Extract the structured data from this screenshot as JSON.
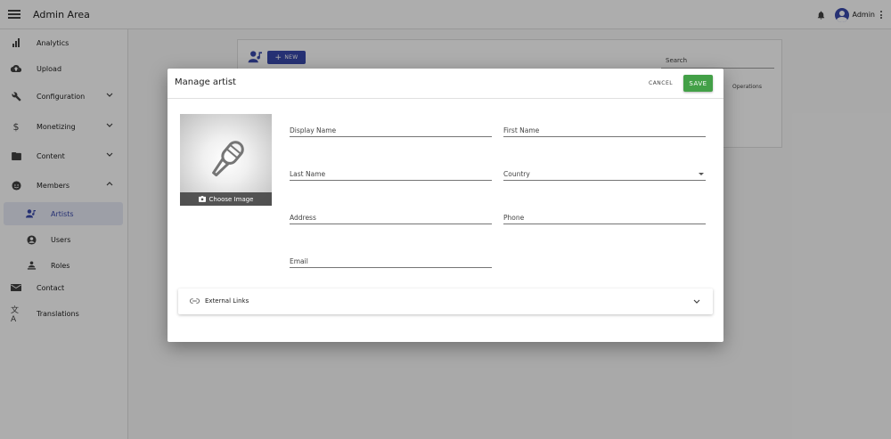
{
  "app": {
    "title": "Admin Area",
    "user_label": "Admin"
  },
  "sidebar": {
    "items": [
      {
        "label": "Analytics",
        "icon": "bar-chart-icon"
      },
      {
        "label": "Upload",
        "icon": "cloud-upload-icon"
      },
      {
        "label": "Configuration",
        "icon": "wrench-icon"
      },
      {
        "label": "Monetizing",
        "icon": "dollar-icon"
      },
      {
        "label": "Content",
        "icon": "folder-icon"
      },
      {
        "label": "Members",
        "icon": "face-icon"
      },
      {
        "label": "Artists",
        "icon": "artist-icon"
      },
      {
        "label": "Users",
        "icon": "account-circle-icon"
      },
      {
        "label": "Roles",
        "icon": "roles-icon"
      },
      {
        "label": "Contact",
        "icon": "mail-icon"
      },
      {
        "label": "Translations",
        "icon": "translate-icon"
      }
    ]
  },
  "background": {
    "new_label": "NEW",
    "search_label": "Search",
    "operations_label": "Operations"
  },
  "dialog": {
    "title": "Manage artist",
    "cancel_label": "CANCEL",
    "save_label": "SAVE",
    "choose_image_label": "Choose Image",
    "fields": {
      "display_name": "Display Name",
      "first_name": "First Name",
      "last_name": "Last Name",
      "country": "Country",
      "address": "Address",
      "phone": "Phone",
      "email": "Email"
    },
    "external_links_label": "External Links"
  },
  "colors": {
    "accent": "#3949ab",
    "save": "#43a047",
    "active_bg": "#e8eaf6"
  }
}
